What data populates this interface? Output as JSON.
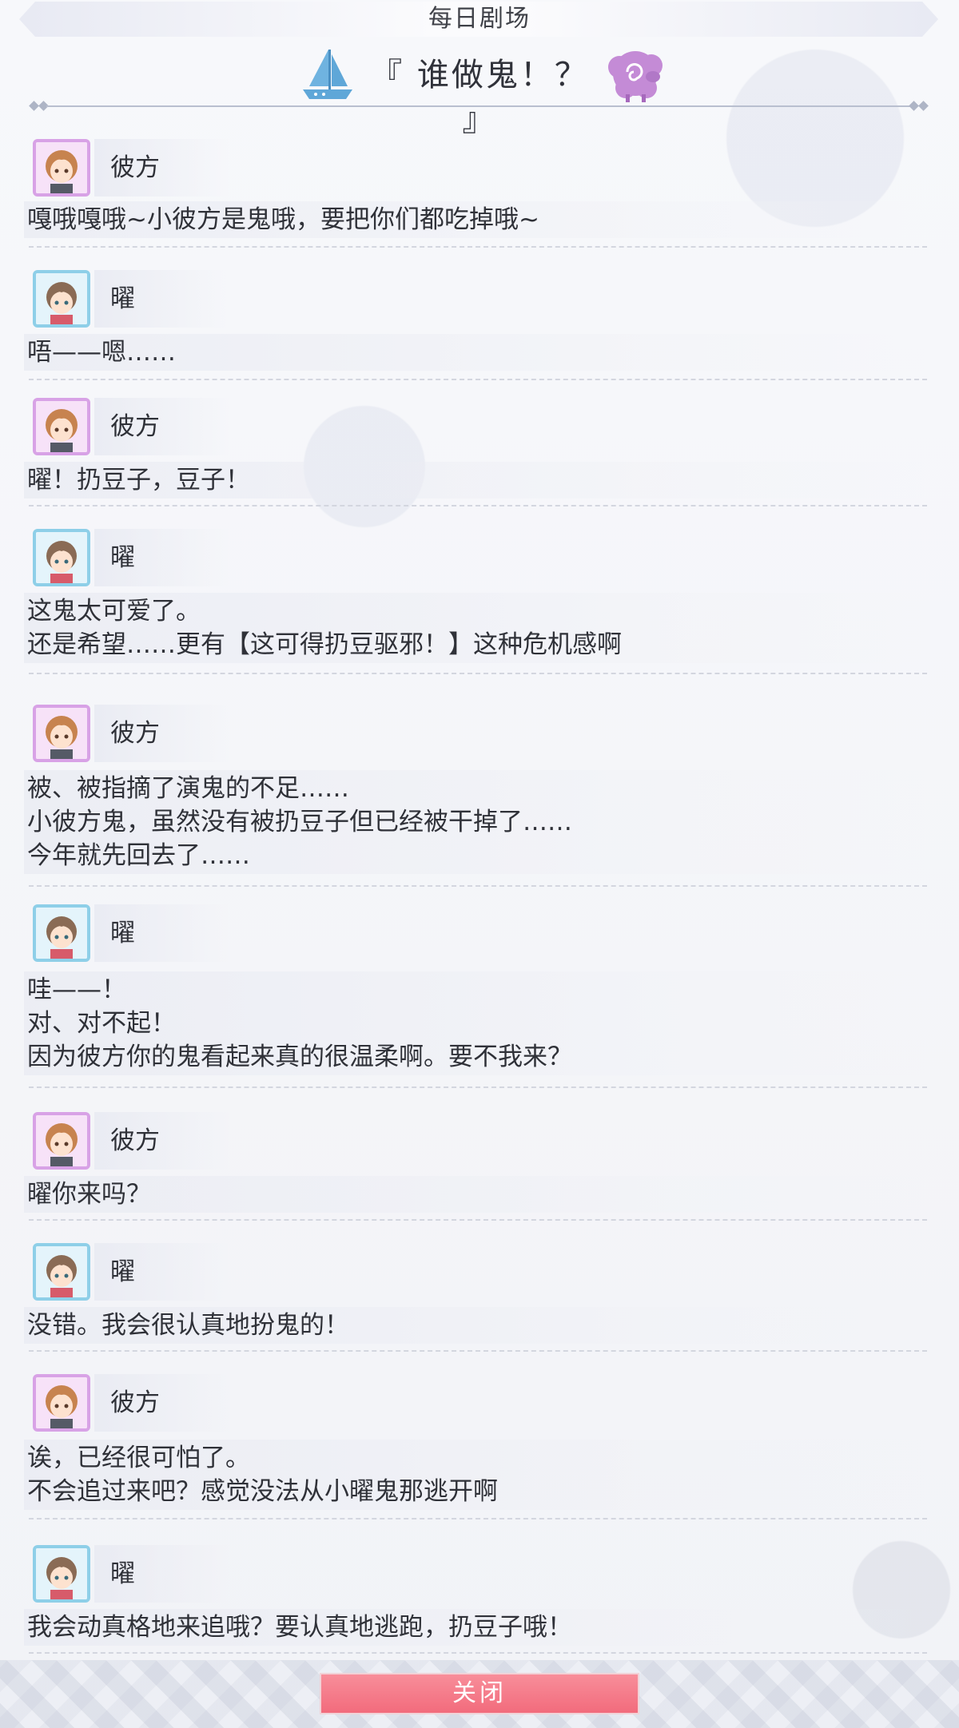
{
  "header": {
    "title": "每日剧场",
    "episode_title": "『 谁做鬼！？ 』"
  },
  "icons": {
    "boat": "sailboat-icon",
    "sheep": "sheep-icon",
    "portrait_kanata": "kanata-portrait",
    "portrait_you": "you-portrait"
  },
  "colors": {
    "kanata_frame": "#d8a2e6",
    "you_frame": "#8ecfe8",
    "boat": "#5fa7d8",
    "sheep": "#c48bd6",
    "close_button": "#f26b7c"
  },
  "dialogue": [
    {
      "speaker": "彼方",
      "text": "嘎哦嘎哦~小彼方是鬼哦，要把你们都吃掉哦~"
    },
    {
      "speaker": "曜",
      "text": "唔——嗯……"
    },
    {
      "speaker": "彼方",
      "text": "曜！扔豆子，豆子！"
    },
    {
      "speaker": "曜",
      "text": "这鬼太可爱了。\n还是希望……更有【这可得扔豆驱邪！】这种危机感啊"
    },
    {
      "speaker": "彼方",
      "text": "被、被指摘了演鬼的不足……\n小彼方鬼，虽然没有被扔豆子但已经被干掉了……\n今年就先回去了……"
    },
    {
      "speaker": "曜",
      "text": "哇——！\n对、对不起！\n因为彼方你的鬼看起来真的很温柔啊。要不我来？"
    },
    {
      "speaker": "彼方",
      "text": "曜你来吗？"
    },
    {
      "speaker": "曜",
      "text": "没错。我会很认真地扮鬼的！"
    },
    {
      "speaker": "彼方",
      "text": "诶，已经很可怕了。\n不会追过来吧？感觉没法从小曜鬼那逃开啊"
    },
    {
      "speaker": "曜",
      "text": "我会动真格地来追哦？要认真地逃跑，扔豆子哦！"
    }
  ],
  "footer": {
    "close_label": "关闭"
  }
}
